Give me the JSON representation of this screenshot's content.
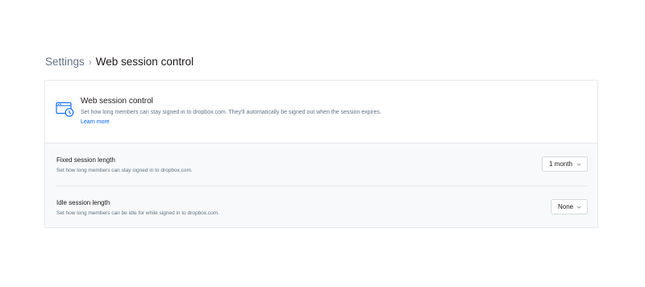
{
  "breadcrumb": {
    "root": "Settings",
    "separator": "›",
    "current": "Web session control"
  },
  "header": {
    "icon": "browser-clock-icon",
    "title": "Web session control",
    "description": "Set how long members can stay signed in to dropbox.com. They'll automatically be signed out when the session expires.",
    "link": "Learn more"
  },
  "settings": [
    {
      "title": "Fixed session length",
      "description": "Set how long members can stay signed in to dropbox.com.",
      "value": "1 month"
    },
    {
      "title": "Idle session length",
      "description": "Set how long members can be idle for while signed in to dropbox.com.",
      "value": "None"
    }
  ],
  "colors": {
    "accent": "#0061fe",
    "text_primary": "#1e1919",
    "text_secondary": "#637282",
    "border": "#e6e8eb",
    "panel_background": "#f7f9fa"
  }
}
